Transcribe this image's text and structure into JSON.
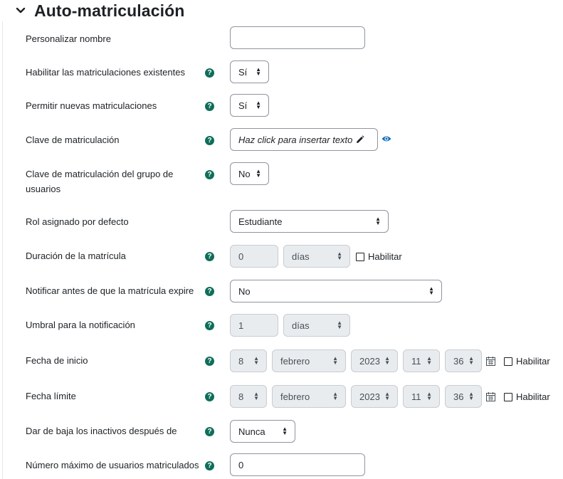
{
  "section": {
    "title": "Auto-matriculación"
  },
  "fields": {
    "custom_name": {
      "label": "Personalizar nombre",
      "value": ""
    },
    "existing": {
      "label": "Habilitar las matriculaciones existentes",
      "value": "Sí"
    },
    "new": {
      "label": "Permitir nuevas matriculaciones",
      "value": "Sí"
    },
    "key": {
      "label": "Clave de matriculación",
      "placeholder": "Haz click para insertar texto"
    },
    "group_key": {
      "label_line1": "Clave de matriculación del grupo de",
      "label_line2": "usuarios",
      "value": "No"
    },
    "role": {
      "label": "Rol asignado por defecto",
      "value": "Estudiante"
    },
    "duration": {
      "label": "Duración de la matrícula",
      "value": "0",
      "unit": "días",
      "enable": "Habilitar"
    },
    "notify": {
      "label": "Notificar antes de que la matrícula expire",
      "value": "No"
    },
    "threshold": {
      "label": "Umbral para la notificación",
      "value": "1",
      "unit": "días"
    },
    "start": {
      "label": "Fecha de inicio",
      "day": "8",
      "month": "febrero",
      "year": "2023",
      "hour": "11",
      "minute": "36",
      "enable": "Habilitar"
    },
    "end": {
      "label": "Fecha límite",
      "day": "8",
      "month": "febrero",
      "year": "2023",
      "hour": "11",
      "minute": "36",
      "enable": "Habilitar"
    },
    "inactive": {
      "label": "Dar de baja los inactivos después de",
      "value": "Nunca"
    },
    "max": {
      "label": "Número máximo de usuarios matriculados",
      "value": "0"
    }
  },
  "help_glyph": "?",
  "icons": {
    "section_toggle": "chevron-down-icon",
    "help": "question-circle-icon",
    "edit": "pencil-icon",
    "reveal": "eye-icon",
    "calendar": "calendar-icon"
  },
  "colors": {
    "help": "#0f6e5a",
    "link": "#0f6cbf",
    "border": "#8f959e",
    "disabled_bg": "#e9ecef"
  }
}
